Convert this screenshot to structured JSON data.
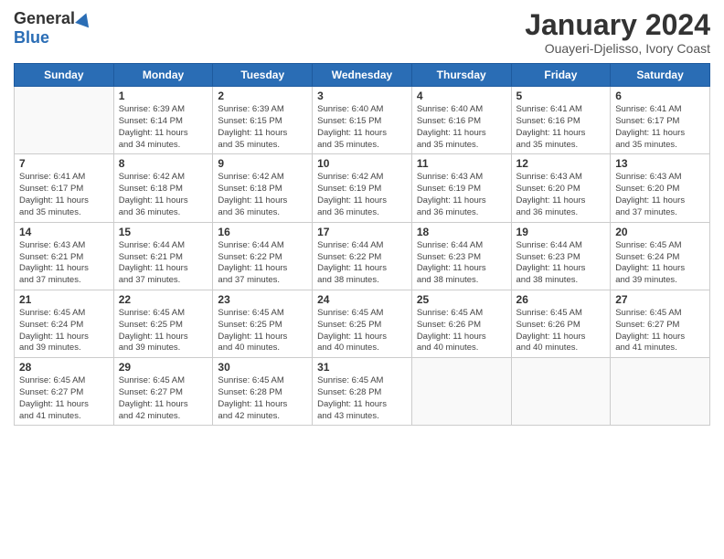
{
  "header": {
    "logo_general": "General",
    "logo_blue": "Blue",
    "title": "January 2024",
    "subtitle": "Ouayeri-Djelisso, Ivory Coast"
  },
  "weekdays": [
    "Sunday",
    "Monday",
    "Tuesday",
    "Wednesday",
    "Thursday",
    "Friday",
    "Saturday"
  ],
  "weeks": [
    [
      {
        "date": "",
        "info": ""
      },
      {
        "date": "1",
        "info": "Sunrise: 6:39 AM\nSunset: 6:14 PM\nDaylight: 11 hours\nand 34 minutes."
      },
      {
        "date": "2",
        "info": "Sunrise: 6:39 AM\nSunset: 6:15 PM\nDaylight: 11 hours\nand 35 minutes."
      },
      {
        "date": "3",
        "info": "Sunrise: 6:40 AM\nSunset: 6:15 PM\nDaylight: 11 hours\nand 35 minutes."
      },
      {
        "date": "4",
        "info": "Sunrise: 6:40 AM\nSunset: 6:16 PM\nDaylight: 11 hours\nand 35 minutes."
      },
      {
        "date": "5",
        "info": "Sunrise: 6:41 AM\nSunset: 6:16 PM\nDaylight: 11 hours\nand 35 minutes."
      },
      {
        "date": "6",
        "info": "Sunrise: 6:41 AM\nSunset: 6:17 PM\nDaylight: 11 hours\nand 35 minutes."
      }
    ],
    [
      {
        "date": "7",
        "info": "Sunrise: 6:41 AM\nSunset: 6:17 PM\nDaylight: 11 hours\nand 35 minutes."
      },
      {
        "date": "8",
        "info": "Sunrise: 6:42 AM\nSunset: 6:18 PM\nDaylight: 11 hours\nand 36 minutes."
      },
      {
        "date": "9",
        "info": "Sunrise: 6:42 AM\nSunset: 6:18 PM\nDaylight: 11 hours\nand 36 minutes."
      },
      {
        "date": "10",
        "info": "Sunrise: 6:42 AM\nSunset: 6:19 PM\nDaylight: 11 hours\nand 36 minutes."
      },
      {
        "date": "11",
        "info": "Sunrise: 6:43 AM\nSunset: 6:19 PM\nDaylight: 11 hours\nand 36 minutes."
      },
      {
        "date": "12",
        "info": "Sunrise: 6:43 AM\nSunset: 6:20 PM\nDaylight: 11 hours\nand 36 minutes."
      },
      {
        "date": "13",
        "info": "Sunrise: 6:43 AM\nSunset: 6:20 PM\nDaylight: 11 hours\nand 37 minutes."
      }
    ],
    [
      {
        "date": "14",
        "info": "Sunrise: 6:43 AM\nSunset: 6:21 PM\nDaylight: 11 hours\nand 37 minutes."
      },
      {
        "date": "15",
        "info": "Sunrise: 6:44 AM\nSunset: 6:21 PM\nDaylight: 11 hours\nand 37 minutes."
      },
      {
        "date": "16",
        "info": "Sunrise: 6:44 AM\nSunset: 6:22 PM\nDaylight: 11 hours\nand 37 minutes."
      },
      {
        "date": "17",
        "info": "Sunrise: 6:44 AM\nSunset: 6:22 PM\nDaylight: 11 hours\nand 38 minutes."
      },
      {
        "date": "18",
        "info": "Sunrise: 6:44 AM\nSunset: 6:23 PM\nDaylight: 11 hours\nand 38 minutes."
      },
      {
        "date": "19",
        "info": "Sunrise: 6:44 AM\nSunset: 6:23 PM\nDaylight: 11 hours\nand 38 minutes."
      },
      {
        "date": "20",
        "info": "Sunrise: 6:45 AM\nSunset: 6:24 PM\nDaylight: 11 hours\nand 39 minutes."
      }
    ],
    [
      {
        "date": "21",
        "info": "Sunrise: 6:45 AM\nSunset: 6:24 PM\nDaylight: 11 hours\nand 39 minutes."
      },
      {
        "date": "22",
        "info": "Sunrise: 6:45 AM\nSunset: 6:25 PM\nDaylight: 11 hours\nand 39 minutes."
      },
      {
        "date": "23",
        "info": "Sunrise: 6:45 AM\nSunset: 6:25 PM\nDaylight: 11 hours\nand 40 minutes."
      },
      {
        "date": "24",
        "info": "Sunrise: 6:45 AM\nSunset: 6:25 PM\nDaylight: 11 hours\nand 40 minutes."
      },
      {
        "date": "25",
        "info": "Sunrise: 6:45 AM\nSunset: 6:26 PM\nDaylight: 11 hours\nand 40 minutes."
      },
      {
        "date": "26",
        "info": "Sunrise: 6:45 AM\nSunset: 6:26 PM\nDaylight: 11 hours\nand 40 minutes."
      },
      {
        "date": "27",
        "info": "Sunrise: 6:45 AM\nSunset: 6:27 PM\nDaylight: 11 hours\nand 41 minutes."
      }
    ],
    [
      {
        "date": "28",
        "info": "Sunrise: 6:45 AM\nSunset: 6:27 PM\nDaylight: 11 hours\nand 41 minutes."
      },
      {
        "date": "29",
        "info": "Sunrise: 6:45 AM\nSunset: 6:27 PM\nDaylight: 11 hours\nand 42 minutes."
      },
      {
        "date": "30",
        "info": "Sunrise: 6:45 AM\nSunset: 6:28 PM\nDaylight: 11 hours\nand 42 minutes."
      },
      {
        "date": "31",
        "info": "Sunrise: 6:45 AM\nSunset: 6:28 PM\nDaylight: 11 hours\nand 43 minutes."
      },
      {
        "date": "",
        "info": ""
      },
      {
        "date": "",
        "info": ""
      },
      {
        "date": "",
        "info": ""
      }
    ]
  ]
}
